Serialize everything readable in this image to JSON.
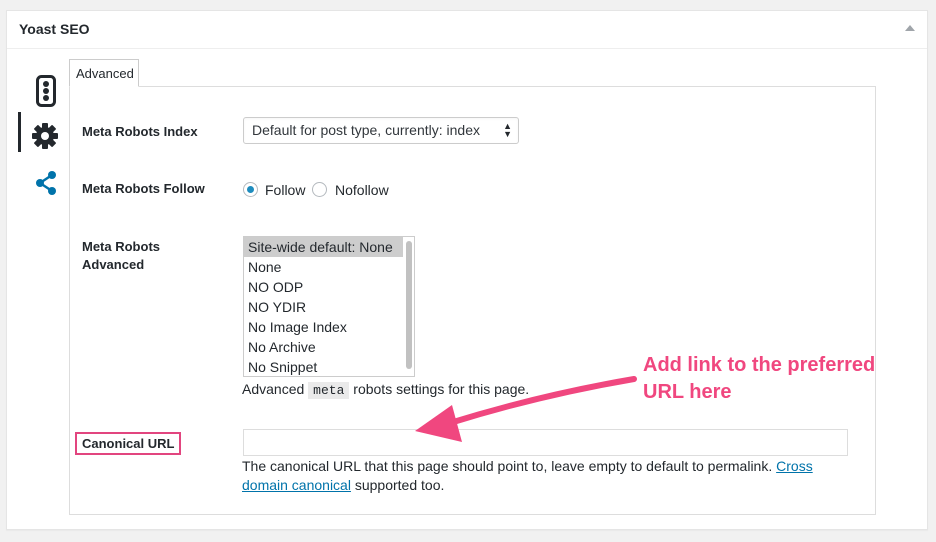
{
  "metabox": {
    "title": "Yoast SEO"
  },
  "nav": {
    "icons": [
      "traffic-light-icon",
      "gear-icon",
      "share-icon"
    ],
    "active": "gear-icon"
  },
  "tab": {
    "label": "Advanced"
  },
  "fields": {
    "robots_index": {
      "label": "Meta Robots Index",
      "value": "Default for post type, currently: index"
    },
    "robots_follow": {
      "label": "Meta Robots Follow",
      "options": [
        "Follow",
        "Nofollow"
      ],
      "selected": "Follow"
    },
    "robots_advanced": {
      "label_line1": "Meta Robots",
      "label_line2": "Advanced",
      "options": [
        "Site-wide default: None",
        "None",
        "NO ODP",
        "NO YDIR",
        "No Image Index",
        "No Archive",
        "No Snippet"
      ],
      "selected": "Site-wide default: None",
      "help_prefix": "Advanced",
      "help_code": "meta",
      "help_suffix": "robots settings for this page."
    },
    "canonical": {
      "label": "Canonical URL",
      "value": "",
      "help_text": "The canonical URL that this page should point to, leave empty to default to permalink.",
      "help_link_part1": "Cross",
      "help_link_part2": "domain canonical",
      "help_suffix": "supported too."
    }
  },
  "annotation": {
    "line1": "Add link to the preferred",
    "line2": "URL here",
    "color": "#f0477f"
  }
}
